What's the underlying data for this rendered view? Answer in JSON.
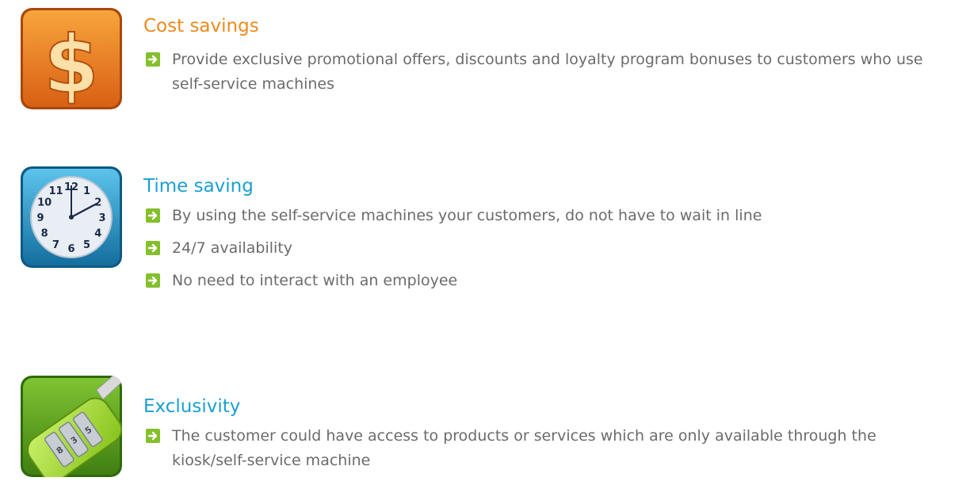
{
  "sections": [
    {
      "icon": "dollar-sign-icon",
      "color": "#ec8a1d",
      "title": "Cost savings",
      "bullets": [
        "Provide exclusive promotional offers, discounts and loyalty program bonuses to customers who use self-service machines"
      ]
    },
    {
      "icon": "clock-icon",
      "color": "#1a9fd3",
      "title": "Time saving",
      "clock_numbers": [
        "12",
        "1",
        "2",
        "3",
        "4",
        "5",
        "6",
        "7",
        "8",
        "9",
        "10",
        "11"
      ],
      "bullets": [
        "By using the self-service machines your customers, do not have to wait in line",
        "24/7 availability",
        "No need to interact with an employee"
      ]
    },
    {
      "icon": "combination-lock-icon",
      "color": "#1a9fd3",
      "title": "Exclusivity",
      "bullets": [
        "The customer could have access to products or services which are only available through the kiosk/self-service machine"
      ]
    }
  ],
  "colors": {
    "bullet_arrow": "#84c02c",
    "text": "#6b6b6b"
  }
}
